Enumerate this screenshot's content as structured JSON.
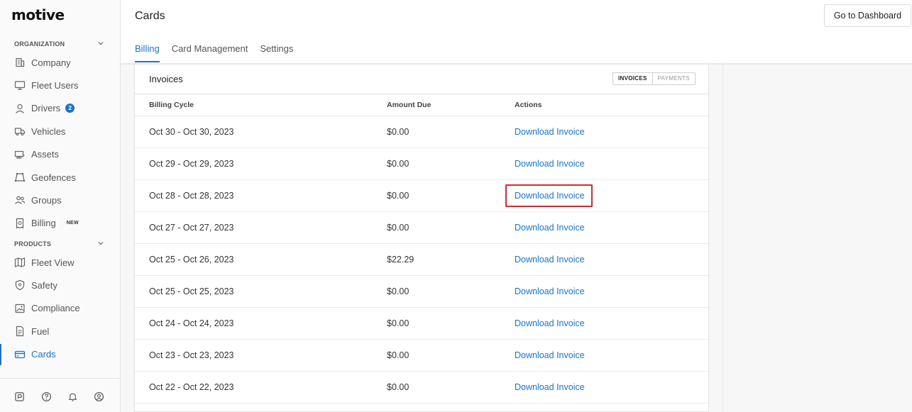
{
  "brand": {
    "logo_text": "motive"
  },
  "sidebar": {
    "organization_label": "ORGANIZATION",
    "products_label": "PRODUCTS",
    "org_items": [
      {
        "label": "Company",
        "icon": "building-icon"
      },
      {
        "label": "Fleet Users",
        "icon": "monitor-icon"
      },
      {
        "label": "Drivers",
        "icon": "person-icon",
        "badge": "2"
      },
      {
        "label": "Vehicles",
        "icon": "truck-icon"
      },
      {
        "label": "Assets",
        "icon": "trailer-icon"
      },
      {
        "label": "Geofences",
        "icon": "geofence-icon"
      },
      {
        "label": "Groups",
        "icon": "group-icon"
      },
      {
        "label": "Billing",
        "icon": "receipt-icon",
        "tag": "NEW"
      }
    ],
    "product_items": [
      {
        "label": "Fleet View",
        "icon": "map-icon"
      },
      {
        "label": "Safety",
        "icon": "shield-icon"
      },
      {
        "label": "Compliance",
        "icon": "image-icon"
      },
      {
        "label": "Fuel",
        "icon": "document-icon"
      },
      {
        "label": "Cards",
        "icon": "card-icon",
        "active": true
      }
    ],
    "footer_icons": [
      "app-icon",
      "help-icon",
      "bell-icon",
      "account-icon"
    ]
  },
  "header": {
    "title": "Cards",
    "dashboard_button": "Go to Dashboard",
    "tabs": [
      {
        "label": "Billing",
        "active": true
      },
      {
        "label": "Card Management"
      },
      {
        "label": "Settings"
      }
    ]
  },
  "invoices": {
    "title": "Invoices",
    "toggle": {
      "invoices": "INVOICES",
      "payments": "PAYMENTS"
    },
    "columns": {
      "billing_cycle": "Billing Cycle",
      "amount_due": "Amount Due",
      "actions": "Actions"
    },
    "rows": [
      {
        "cycle": "Oct 30 - Oct 30, 2023",
        "amount": "$0.00",
        "action": "Download Invoice"
      },
      {
        "cycle": "Oct 29 - Oct 29, 2023",
        "amount": "$0.00",
        "action": "Download Invoice"
      },
      {
        "cycle": "Oct 28 - Oct 28, 2023",
        "amount": "$0.00",
        "action": "Download Invoice",
        "highlighted": true
      },
      {
        "cycle": "Oct 27 - Oct 27, 2023",
        "amount": "$0.00",
        "action": "Download Invoice"
      },
      {
        "cycle": "Oct 25 - Oct 26, 2023",
        "amount": "$22.29",
        "action": "Download Invoice"
      },
      {
        "cycle": "Oct 25 - Oct 25, 2023",
        "amount": "$0.00",
        "action": "Download Invoice"
      },
      {
        "cycle": "Oct 24 - Oct 24, 2023",
        "amount": "$0.00",
        "action": "Download Invoice"
      },
      {
        "cycle": "Oct 23 - Oct 23, 2023",
        "amount": "$0.00",
        "action": "Download Invoice"
      },
      {
        "cycle": "Oct 22 - Oct 22, 2023",
        "amount": "$0.00",
        "action": "Download Invoice"
      }
    ]
  },
  "colors": {
    "accent": "#1a73c9",
    "highlight": "#d9282f"
  }
}
